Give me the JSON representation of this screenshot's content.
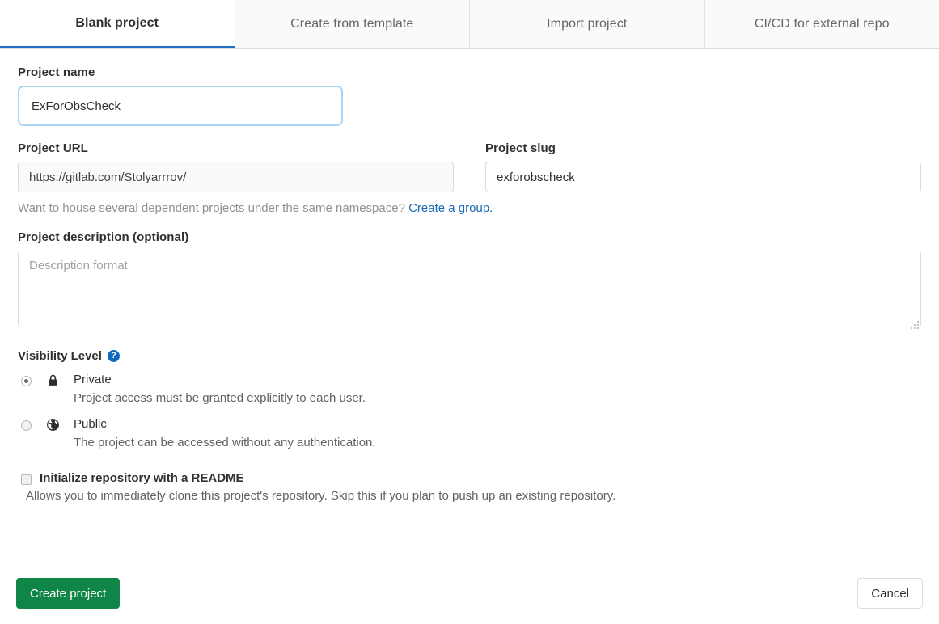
{
  "tabs": [
    {
      "label": "Blank project",
      "active": true
    },
    {
      "label": "Create from template",
      "active": false
    },
    {
      "label": "Import project",
      "active": false
    },
    {
      "label": "CI/CD for external repo",
      "active": false
    }
  ],
  "project_name": {
    "label": "Project name",
    "value": "ExForObsCheck"
  },
  "project_url": {
    "label": "Project URL",
    "value": "https://gitlab.com/Stolyarrrov/"
  },
  "project_slug": {
    "label": "Project slug",
    "value": "exforobscheck"
  },
  "namespace_hint": {
    "text": "Want to house several dependent projects under the same namespace?",
    "link": "Create a group."
  },
  "description": {
    "label": "Project description (optional)",
    "placeholder": "Description format",
    "value": ""
  },
  "visibility": {
    "title": "Visibility Level",
    "help_icon": "question-mark-icon",
    "options": [
      {
        "name": "Private",
        "description": "Project access must be granted explicitly to each user.",
        "icon": "lock-icon",
        "selected": true
      },
      {
        "name": "Public",
        "description": "The project can be accessed without any authentication.",
        "icon": "globe-icon",
        "selected": false
      }
    ]
  },
  "readme": {
    "label": "Initialize repository with a README",
    "description": "Allows you to immediately clone this project's repository. Skip this if you plan to push up an existing repository.",
    "checked": false
  },
  "actions": {
    "create": "Create project",
    "cancel": "Cancel"
  },
  "colors": {
    "accent_blue": "#1f6fc4",
    "link_blue": "#1b69b6",
    "create_green": "#108548",
    "help_blue": "#1068bf"
  }
}
